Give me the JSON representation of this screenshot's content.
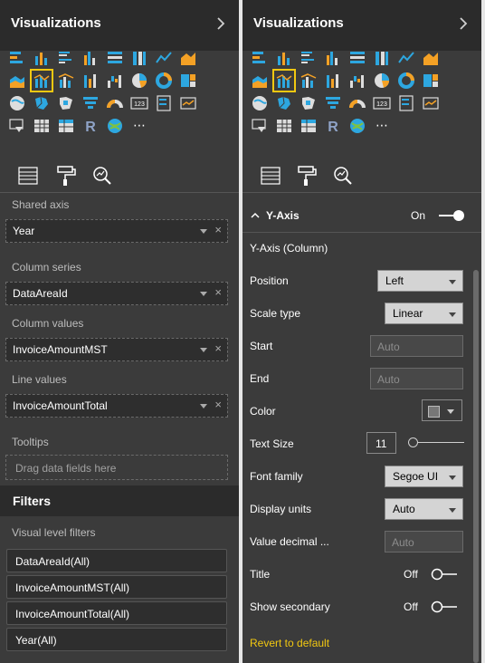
{
  "left": {
    "header": {
      "title": "Visualizations"
    },
    "fields": {
      "shared_axis": {
        "title": "Shared axis",
        "value": "Year"
      },
      "column_series": {
        "title": "Column series",
        "value": "DataAreaId"
      },
      "column_values": {
        "title": "Column values",
        "value": "InvoiceAmountMST"
      },
      "line_values": {
        "title": "Line values",
        "value": "InvoiceAmountTotal"
      },
      "tooltips": {
        "title": "Tooltips",
        "placeholder": "Drag data fields here"
      }
    },
    "filters": {
      "title": "Filters",
      "level_title": "Visual level filters",
      "items": [
        "DataAreaId(All)",
        "InvoiceAmountMST(All)",
        "InvoiceAmountTotal(All)",
        "Year(All)"
      ]
    }
  },
  "right": {
    "header": {
      "title": "Visualizations"
    },
    "y_axis": {
      "title": "Y-Axis",
      "toggle": "On",
      "subtitle": "Y-Axis (Column)",
      "position": {
        "label": "Position",
        "value": "Left"
      },
      "scale_type": {
        "label": "Scale type",
        "value": "Linear"
      },
      "start": {
        "label": "Start",
        "placeholder": "Auto"
      },
      "end": {
        "label": "End",
        "placeholder": "Auto"
      },
      "color": {
        "label": "Color",
        "value": "#777777"
      },
      "text_size": {
        "label": "Text Size",
        "value": "11",
        "slider_level": 0.0
      },
      "font_family": {
        "label": "Font family",
        "value": "Segoe UI"
      },
      "display_units": {
        "label": "Display units",
        "value": "Auto"
      },
      "value_decimal": {
        "label": "Value decimal ...",
        "placeholder": "Auto"
      },
      "title_toggle": {
        "label": "Title",
        "state": "Off"
      },
      "show_secondary": {
        "label": "Show secondary",
        "state": "Off"
      },
      "revert": "Revert to default"
    }
  },
  "icon_tokens": {
    "chevron": "chevron-right-icon",
    "more": "⋯",
    "r": "R",
    "number": "123"
  },
  "colors": {
    "accent": "#f2c811",
    "panel_bg": "#3b3b3b",
    "header_bg": "#2b2b2b",
    "link": "#f2c811"
  }
}
